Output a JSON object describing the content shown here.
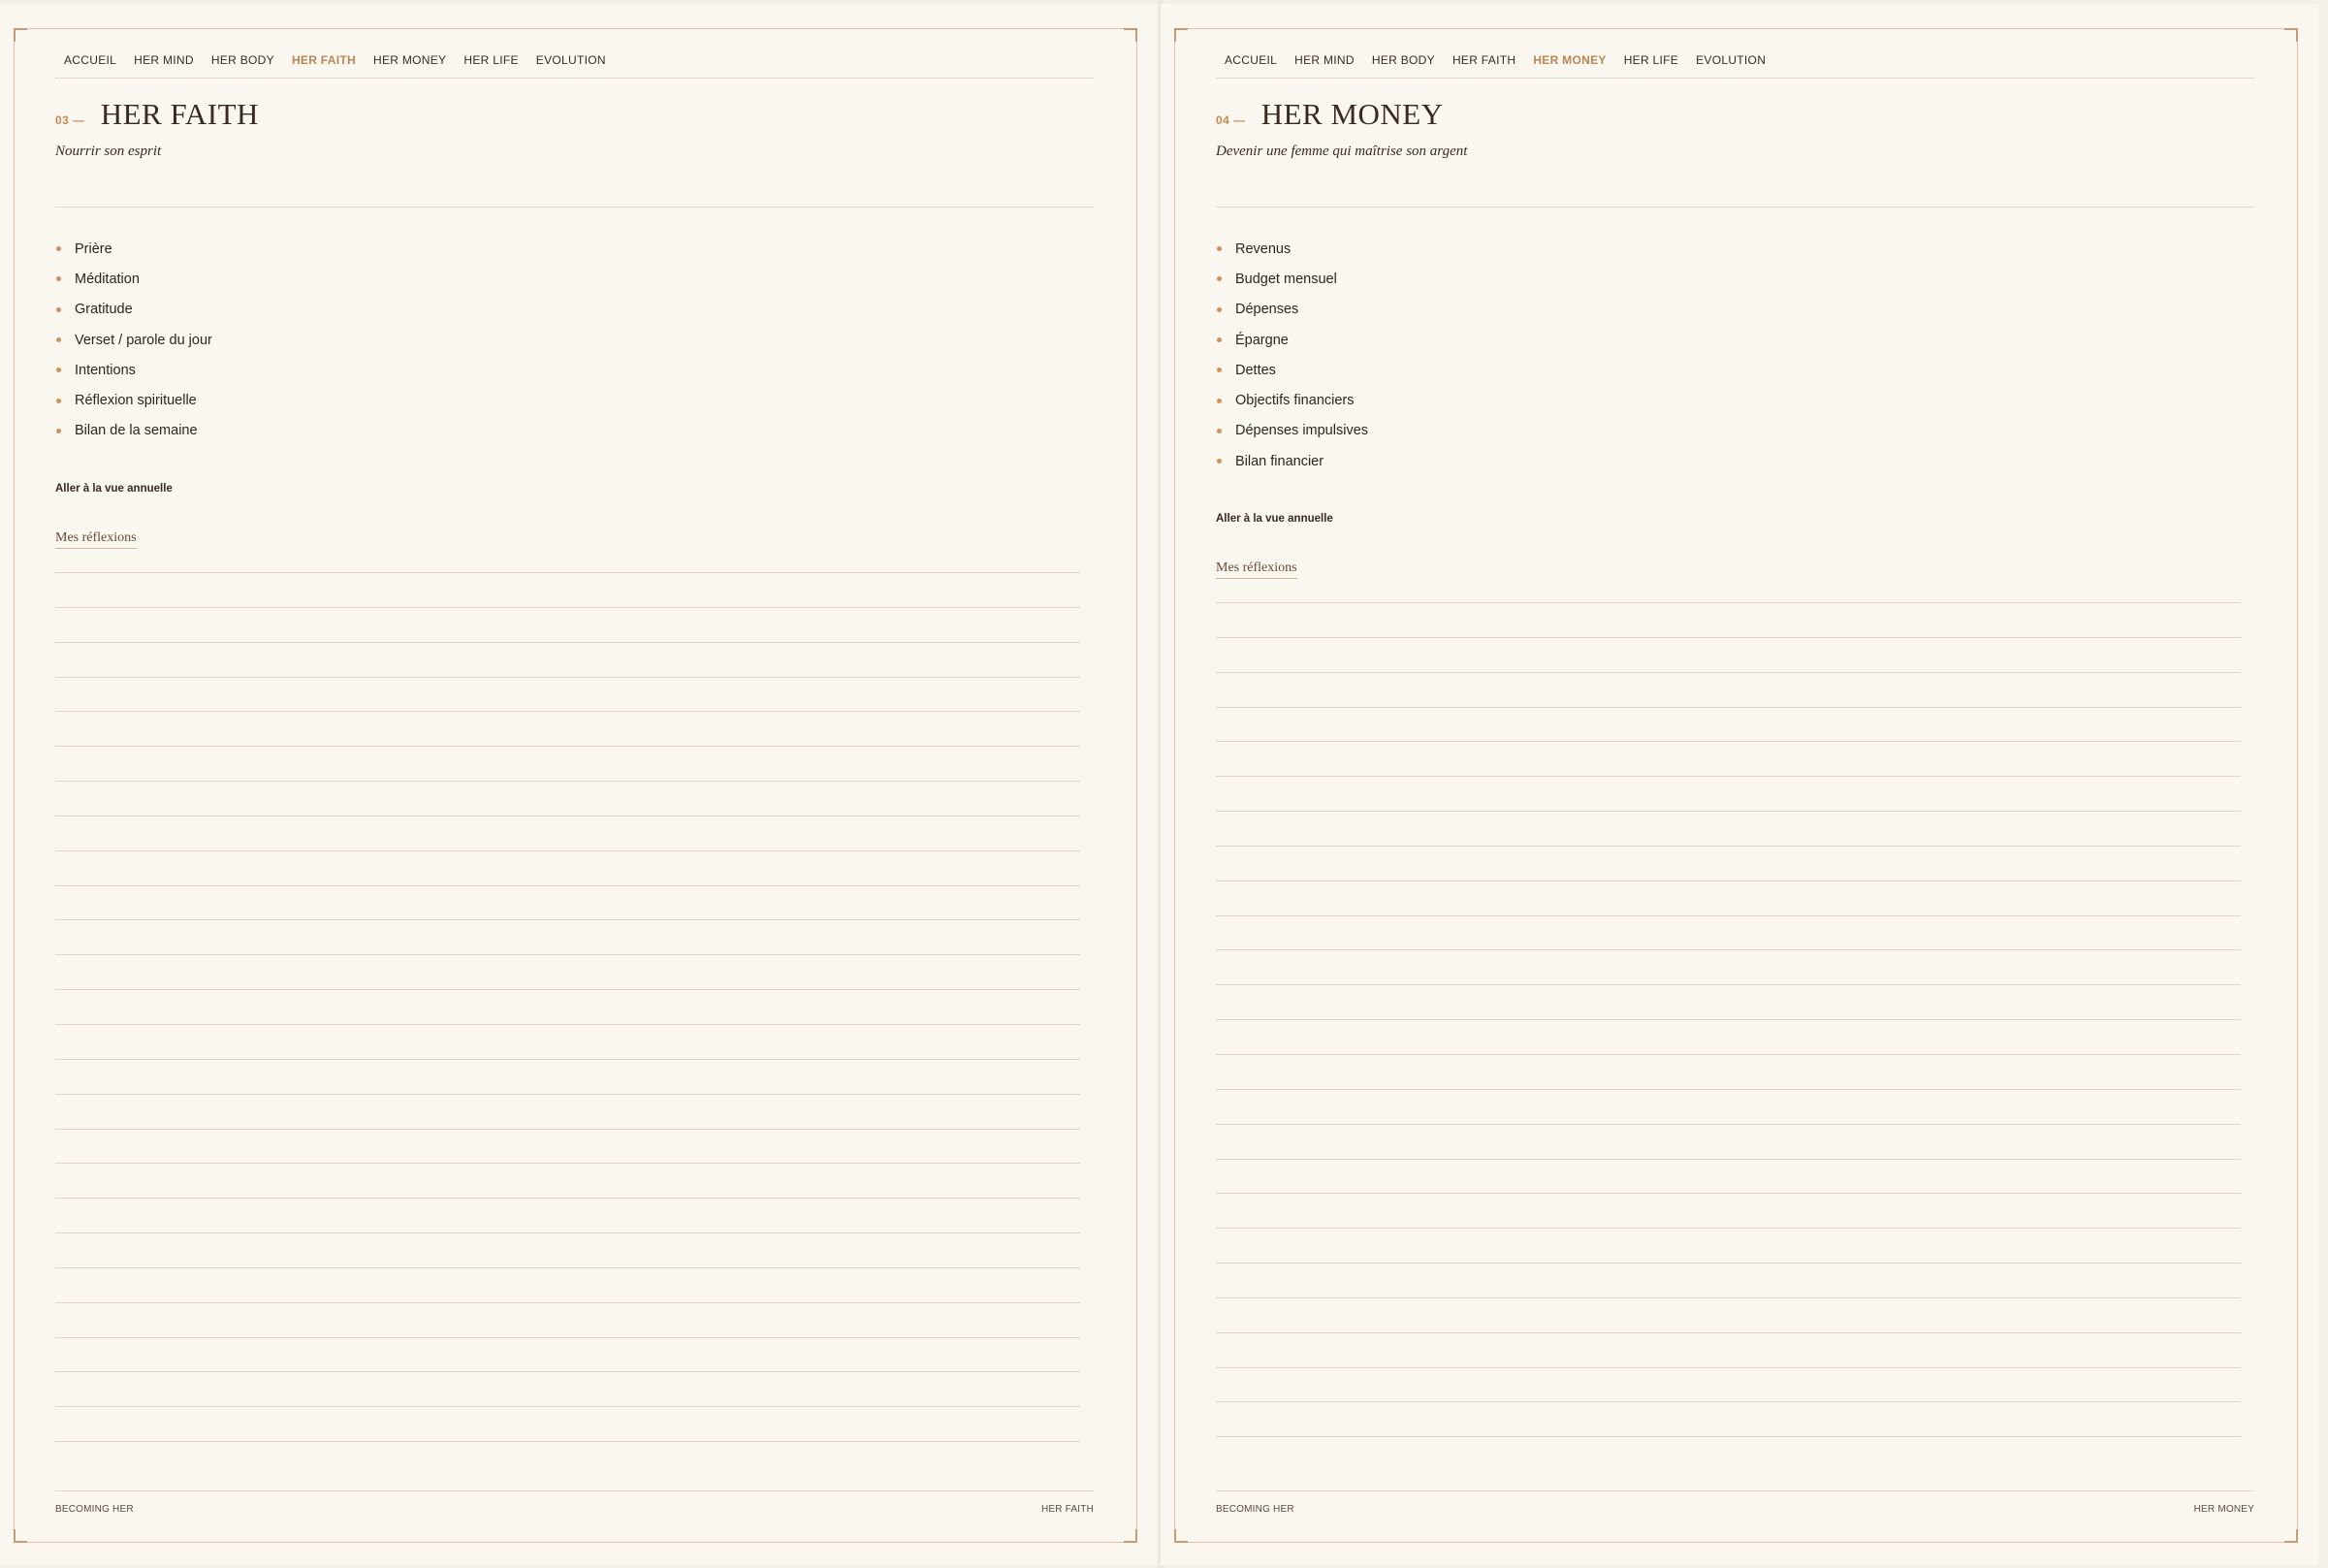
{
  "nav": [
    "ACCUEIL",
    "HER MIND",
    "HER BODY",
    "HER FAITH",
    "HER MONEY",
    "HER LIFE",
    "EVOLUTION"
  ],
  "pages": [
    {
      "number": "03 —",
      "title": "HER FAITH",
      "subtitle": "Nourrir son esprit",
      "active_nav": "HER FAITH",
      "items": [
        "Prière",
        "Méditation",
        "Gratitude",
        "Verset / parole du jour",
        "Intentions",
        "Réflexion spirituelle",
        "Bilan de la semaine"
      ],
      "year_link": "Aller à la vue annuelle",
      "reflections_label": "Mes réflexions",
      "footer_left": "BECOMING HER",
      "footer_right": "HER FAITH"
    },
    {
      "number": "04 —",
      "title": "HER MONEY",
      "subtitle": "Devenir une femme qui maîtrise son argent",
      "active_nav": "HER MONEY",
      "items": [
        "Revenus",
        "Budget mensuel",
        "Dépenses",
        "Épargne",
        "Dettes",
        "Objectifs financiers",
        "Dépenses impulsives",
        "Bilan financier"
      ],
      "year_link": "Aller à la vue annuelle",
      "reflections_label": "Mes réflexions",
      "footer_left": "BECOMING HER",
      "footer_right": "HER MONEY"
    }
  ],
  "colors": {
    "accent": "#b98654",
    "bullet": "#d4905a",
    "frame": "#e7c2a6",
    "paper": "#faf6f0",
    "text": "#3a2a20"
  }
}
